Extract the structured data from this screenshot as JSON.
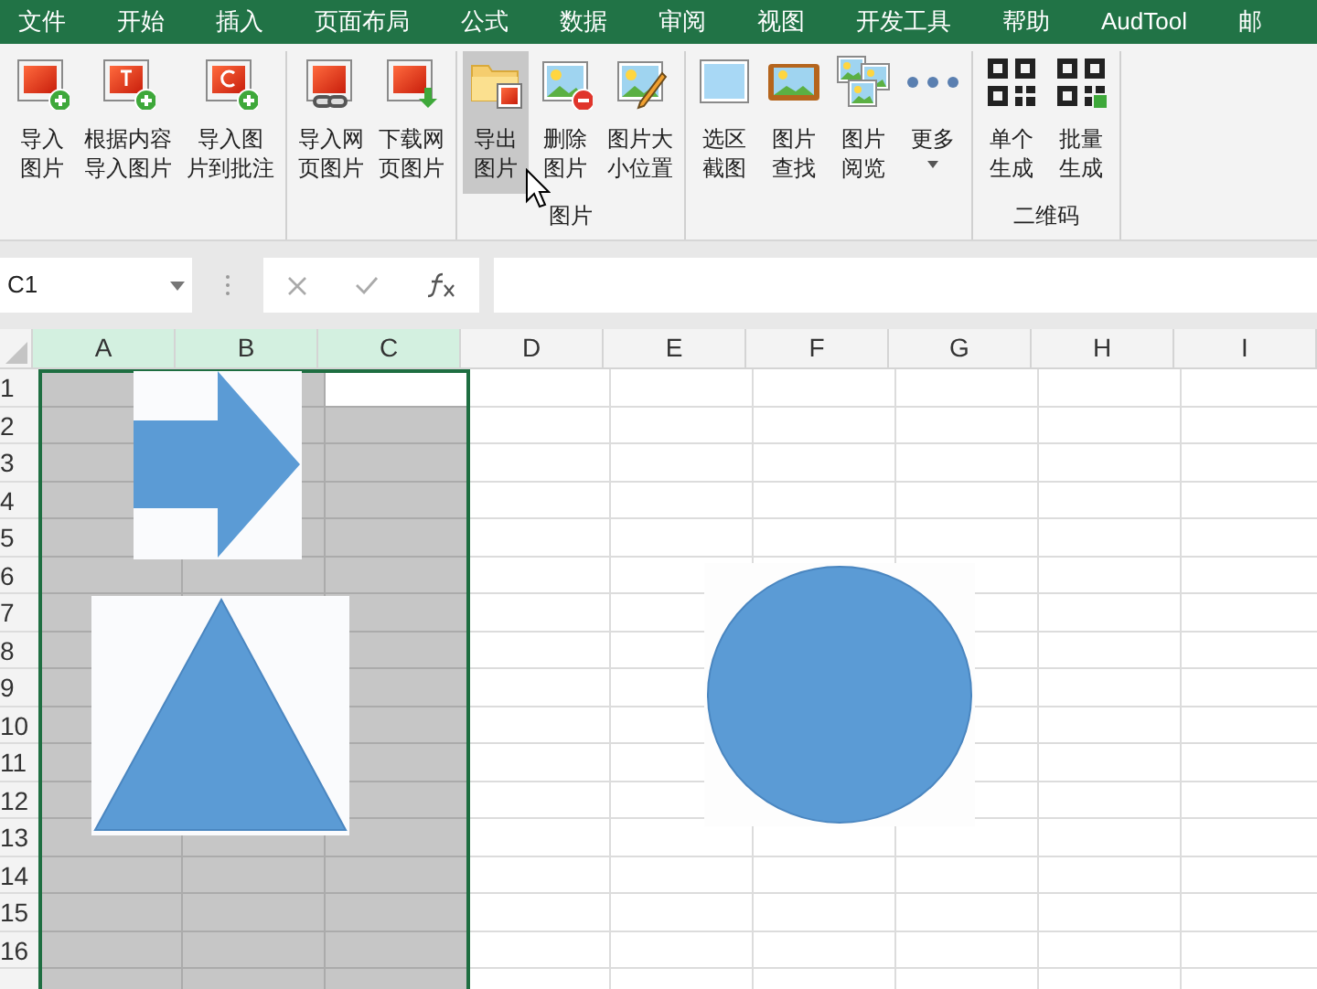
{
  "tabs": [
    {
      "label": "文件"
    },
    {
      "label": "开始"
    },
    {
      "label": "插入"
    },
    {
      "label": "页面布局"
    },
    {
      "label": "公式"
    },
    {
      "label": "数据"
    },
    {
      "label": "审阅"
    },
    {
      "label": "视图"
    },
    {
      "label": "开发工具"
    },
    {
      "label": "帮助"
    },
    {
      "label": "AudTool"
    },
    {
      "label": "邮"
    }
  ],
  "ribbon_groups": [
    {
      "buttons": [
        {
          "lines": [
            "导入",
            "图片"
          ],
          "kind": "import",
          "hovered": false
        },
        {
          "lines": [
            "根据内容",
            "导入图片"
          ],
          "kind": "import-text",
          "hovered": false
        },
        {
          "lines": [
            "导入图",
            "片到批注"
          ],
          "kind": "import-comment",
          "hovered": false
        }
      ]
    },
    {
      "buttons": [
        {
          "lines": [
            "导入网",
            "页图片"
          ],
          "kind": "web",
          "hovered": false
        },
        {
          "lines": [
            "下载网",
            "页图片"
          ],
          "kind": "download",
          "hovered": false
        }
      ]
    },
    {
      "label": "图片",
      "buttons": [
        {
          "lines": [
            "导出",
            "图片"
          ],
          "kind": "export",
          "hovered": true
        },
        {
          "lines": [
            "删除",
            "图片"
          ],
          "kind": "delete",
          "hovered": false
        },
        {
          "lines": [
            "图片大",
            "小位置"
          ],
          "kind": "resize",
          "hovered": false
        }
      ]
    },
    {
      "buttons": [
        {
          "lines": [
            "选区",
            "截图"
          ],
          "kind": "screenshot",
          "hovered": false
        },
        {
          "lines": [
            "图片",
            "查找"
          ],
          "kind": "find",
          "hovered": false
        },
        {
          "lines": [
            "图片",
            "阅览"
          ],
          "kind": "browse",
          "hovered": false
        },
        {
          "lines": [
            "更多"
          ],
          "kind": "more",
          "hovered": false
        }
      ]
    },
    {
      "label": "二维码",
      "buttons": [
        {
          "lines": [
            "单个",
            "生成"
          ],
          "kind": "qr",
          "hovered": false
        },
        {
          "lines": [
            "批量",
            "生成"
          ],
          "kind": "qr-batch",
          "hovered": false
        }
      ]
    }
  ],
  "name_box": {
    "value": "C1"
  },
  "columns": [
    {
      "label": "A",
      "selected": true,
      "active": false
    },
    {
      "label": "B",
      "selected": true,
      "active": false
    },
    {
      "label": "C",
      "selected": true,
      "active": true
    },
    {
      "label": "D",
      "selected": false,
      "active": false
    },
    {
      "label": "E",
      "selected": false,
      "active": false
    },
    {
      "label": "F",
      "selected": false,
      "active": false
    },
    {
      "label": "G",
      "selected": false,
      "active": false
    },
    {
      "label": "H",
      "selected": false,
      "active": false
    },
    {
      "label": "I",
      "selected": false,
      "active": false
    }
  ],
  "rows": [
    {
      "label": "1",
      "active": true
    },
    {
      "label": "2",
      "active": false
    },
    {
      "label": "3",
      "active": false
    },
    {
      "label": "4",
      "active": false
    },
    {
      "label": "5",
      "active": false
    },
    {
      "label": "6",
      "active": false
    },
    {
      "label": "7",
      "active": false
    },
    {
      "label": "8",
      "active": false
    },
    {
      "label": "9",
      "active": false
    },
    {
      "label": "10",
      "active": false
    },
    {
      "label": "11",
      "active": false
    },
    {
      "label": "12",
      "active": false
    },
    {
      "label": "13",
      "active": false
    },
    {
      "label": "14",
      "active": false
    },
    {
      "label": "15",
      "active": false
    },
    {
      "label": "16",
      "active": false
    }
  ],
  "shapes": [
    {
      "kind": "arrow"
    },
    {
      "kind": "triangle"
    },
    {
      "kind": "circle"
    }
  ]
}
